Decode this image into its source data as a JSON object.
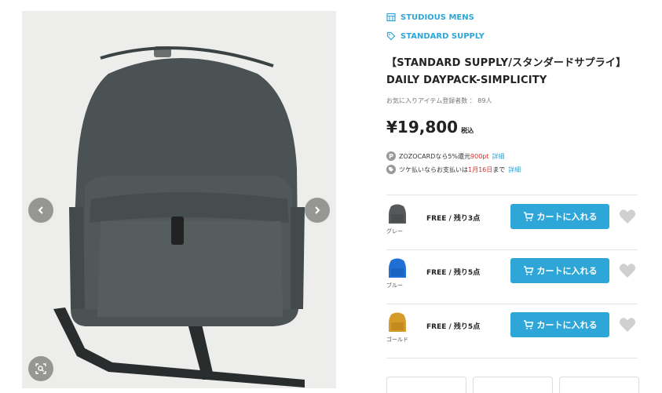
{
  "breadcrumb": {
    "shop": "STUDIOUS MENS",
    "brand": "STANDARD SUPPLY"
  },
  "product": {
    "title": "【STANDARD SUPPLY/スタンダードサプライ】DAILY DAYPACK-SIMPLICITY",
    "favorites": "お気に入りアイテム登録者数 ： 89人",
    "price": "¥19,800",
    "tax_label": "税込"
  },
  "notes": {
    "zozo_icon": "P",
    "zozo_text": "ZOZOCARDなら5%還元",
    "zozo_points": "900pt",
    "zozo_link": "詳細",
    "tsuke_text": "ツケ払いならお支払いは",
    "tsuke_date": "1月16日",
    "tsuke_suffix": "まで",
    "tsuke_link": "詳細"
  },
  "variants": [
    {
      "color_name": "グレー",
      "stock": "FREE / 残り3点",
      "button": "カートに入れる",
      "swatch": "#55595a"
    },
    {
      "color_name": "ブルー",
      "stock": "FREE / 残り5点",
      "button": "カートに入れる",
      "swatch": "#1f6fd4"
    },
    {
      "color_name": "ゴールド",
      "stock": "FREE / 残り5点",
      "button": "カートに入れる",
      "swatch": "#d49a2a"
    }
  ],
  "colors": {
    "accent": "#2ea6d8",
    "price_red": "#d3302f",
    "backpack": "#4a5254"
  },
  "icons": {
    "prev": "chevron-left-icon",
    "next": "chevron-right-icon",
    "zoom": "zoom-search-icon",
    "shop": "store-icon",
    "brand": "tag-icon",
    "cart": "cart-icon",
    "favorite": "heart-icon"
  }
}
